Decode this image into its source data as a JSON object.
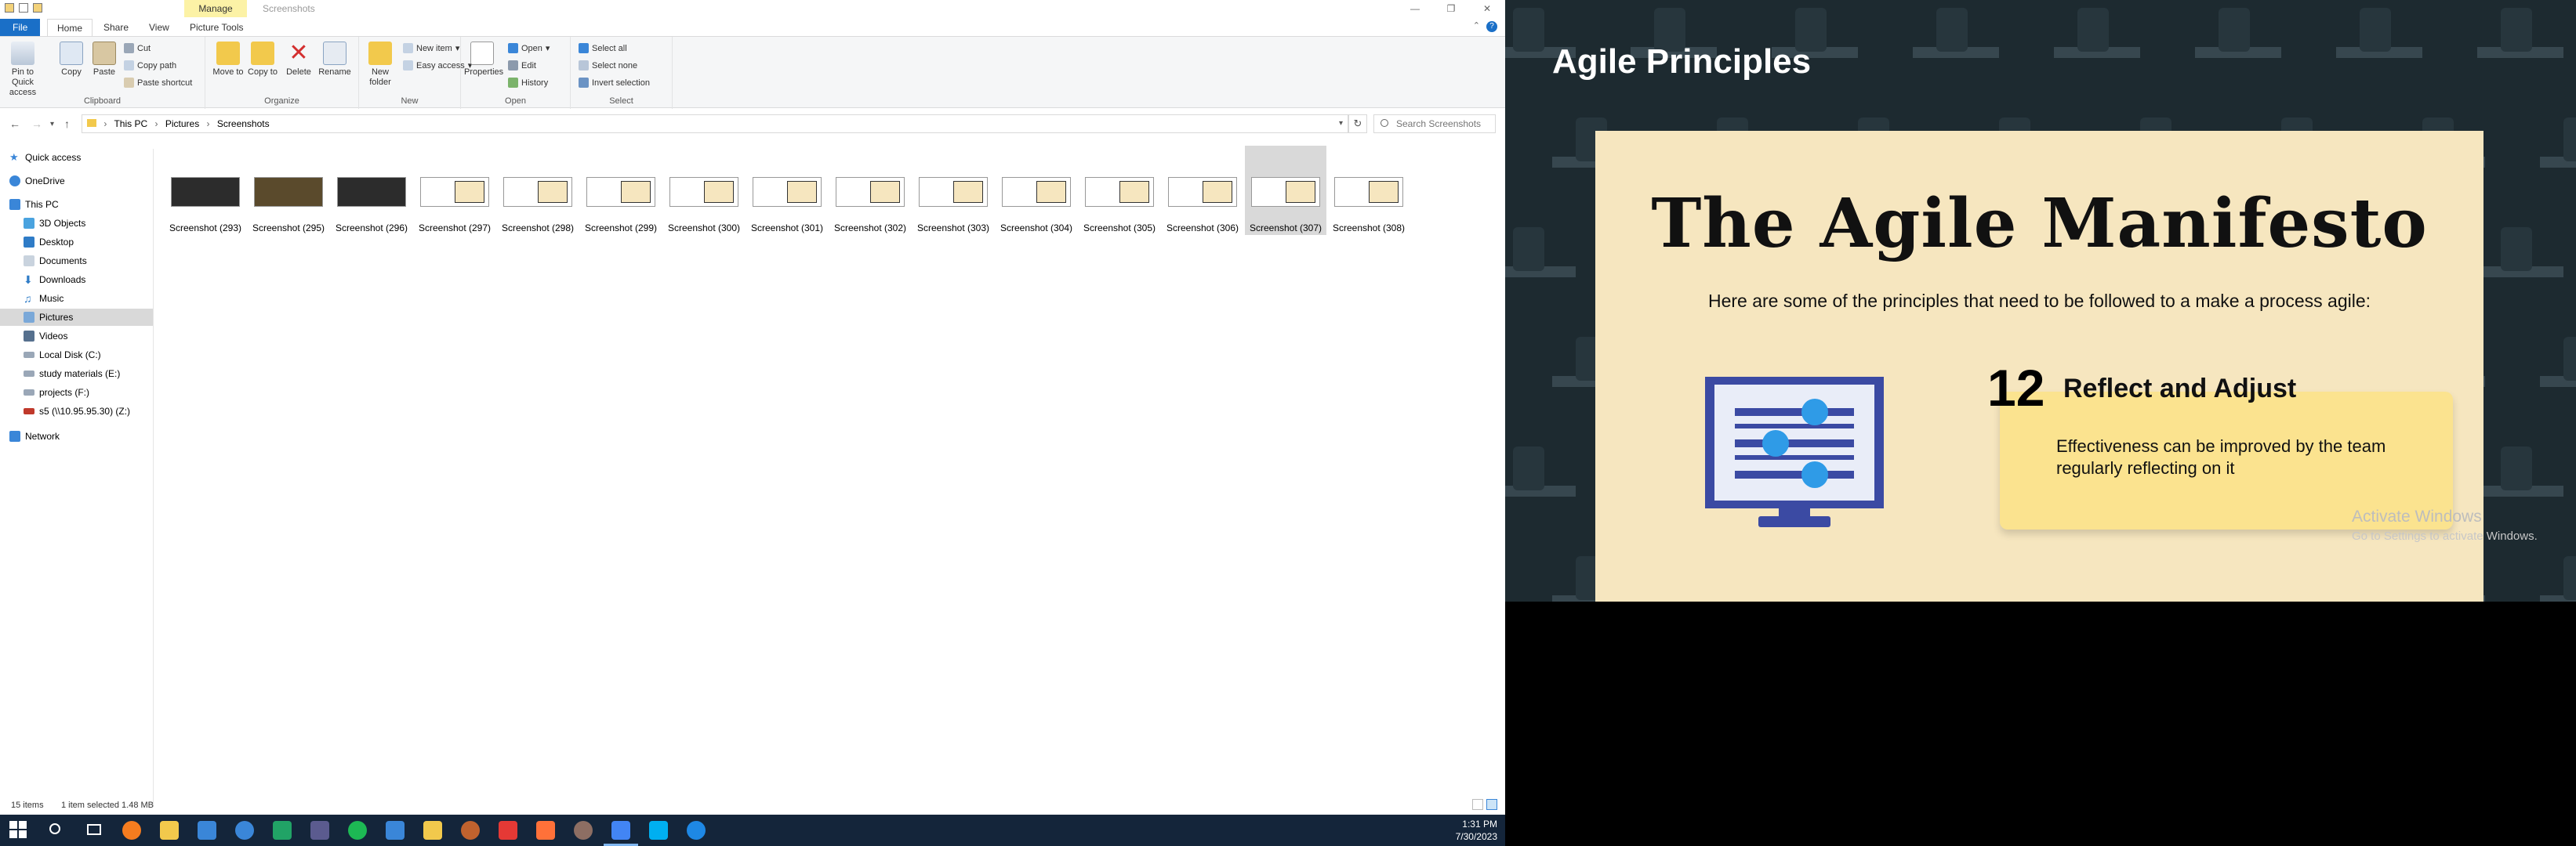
{
  "explorer": {
    "title": "Screenshots",
    "contextual_tab": "Manage",
    "ribbon_tabs": [
      "File",
      "Home",
      "Share",
      "View",
      "Picture Tools"
    ],
    "ribbon": {
      "clipboard": {
        "name": "Clipboard",
        "pin": "Pin to Quick access",
        "copy": "Copy",
        "paste": "Paste",
        "cut": "Cut",
        "copy_path": "Copy path",
        "paste_shortcut": "Paste shortcut"
      },
      "organize": {
        "name": "Organize",
        "move_to": "Move to",
        "copy_to": "Copy to",
        "delete": "Delete",
        "rename": "Rename"
      },
      "new": {
        "name": "New",
        "new_folder": "New folder",
        "new_item": "New item",
        "easy_access": "Easy access"
      },
      "open": {
        "name": "Open",
        "properties": "Properties",
        "open": "Open",
        "edit": "Edit",
        "history": "History"
      },
      "select": {
        "name": "Select",
        "select_all": "Select all",
        "select_none": "Select none",
        "invert": "Invert selection"
      }
    },
    "address": [
      "This PC",
      "Pictures",
      "Screenshots"
    ],
    "search_placeholder": "Search Screenshots",
    "nav": {
      "quick_access": "Quick access",
      "onedrive": "OneDrive",
      "this_pc": "This PC",
      "items": [
        "3D Objects",
        "Desktop",
        "Documents",
        "Downloads",
        "Music",
        "Pictures",
        "Videos",
        "Local Disk (C:)",
        "study materials (E:)",
        "projects (F:)",
        "s5 (\\\\10.95.95.30) (Z:)"
      ],
      "network": "Network",
      "selected": "Pictures"
    },
    "files": [
      "Screenshot (293)",
      "Screenshot (295)",
      "Screenshot (296)",
      "Screenshot (297)",
      "Screenshot (298)",
      "Screenshot (299)",
      "Screenshot (300)",
      "Screenshot (301)",
      "Screenshot (302)",
      "Screenshot (303)",
      "Screenshot (304)",
      "Screenshot (305)",
      "Screenshot (306)",
      "Screenshot (307)",
      "Screenshot (308)"
    ],
    "selected_file": "Screenshot (307)",
    "status": {
      "count": "15 items",
      "selection": "1 item selected  1.48 MB"
    }
  },
  "taskbar": {
    "time": "1:31 PM",
    "date": "7/30/2023",
    "apps": [
      "start-icon",
      "search-icon",
      "task-view-icon",
      "app-orange-icon",
      "file-explorer-icon",
      "store-icon",
      "mail-icon",
      "excel-icon",
      "obs-icon",
      "spotify-icon",
      "photos-icon",
      "pencil-icon",
      "app-brown-icon",
      "opera-icon",
      "firefox-icon",
      "minecraft-icon",
      "chrome-icon",
      "skype-icon",
      "app-blue-icon"
    ]
  },
  "slide": {
    "heading": "Agile Principles",
    "manifesto": "The Agile Manifesto",
    "intro": "Here are some of the principles that need to be followed to a make a process agile:",
    "number": "12",
    "principle_title": "Reflect and Adjust",
    "principle_text": "Effectiveness can be improved by the team regularly reflecting on it",
    "watermark_title": "Activate Windows",
    "watermark_sub": "Go to Settings to activate Windows."
  },
  "colors": {
    "accent": "#1a6fc7",
    "card": "#f6e6bf",
    "note": "#fbe38f",
    "monitor": "#3b4aa3"
  }
}
